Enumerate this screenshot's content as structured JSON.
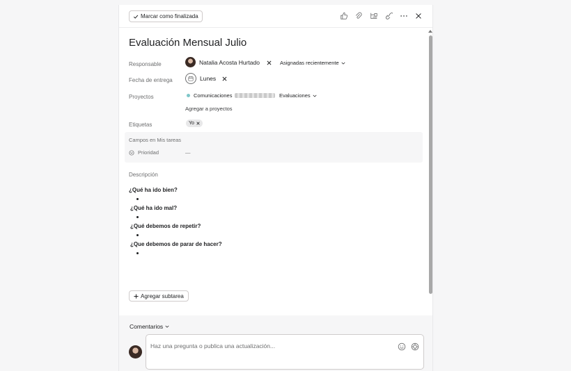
{
  "toolbar": {
    "mark_complete_label": "Marcar como finalizada",
    "icons": [
      "like-icon",
      "attachment-icon",
      "subtask-icon",
      "link-icon",
      "more-icon",
      "close-icon"
    ]
  },
  "task": {
    "title": "Evaluación Mensual Julio"
  },
  "fields": {
    "assignee_label": "Responsable",
    "assignee_name": "Natalia Acosta Hurtado",
    "assigned_recent_label": "Asignadas recientemente",
    "due_label": "Fecha de entrega",
    "due_value": "Lunes",
    "projects_label": "Proyectos",
    "project_name": "Comunicaciones",
    "project_section": "Evaluaciones",
    "add_project_label": "Agregar a proyectos",
    "tags_label": "Etiquetas",
    "tag_value": "Yo"
  },
  "my_tasks_fields": {
    "heading": "Campos en Mis tareas",
    "priority_label": "Prioridad",
    "priority_value": "—"
  },
  "description": {
    "label": "Descripción",
    "sections": [
      "¿Qué ha ido bien?",
      "¿Qué ha ido mal?",
      "¿Qué debemos de repetir?",
      "¿Que debemos de parar de hacer?"
    ]
  },
  "subtask_button_label": "Agregar subtarea",
  "comments": {
    "heading": "Comentarios",
    "placeholder": "Haz una pregunta o publica una actualización..."
  }
}
